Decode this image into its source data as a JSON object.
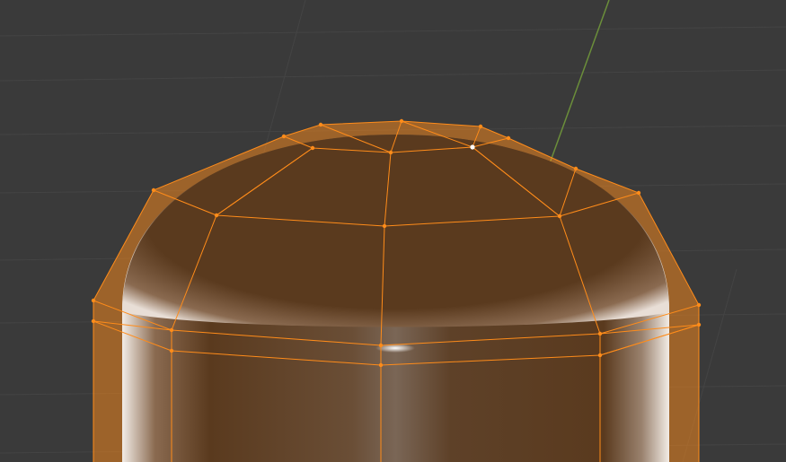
{
  "viewport": {
    "mode": "Edit Mode",
    "background_color": "#3a3a3a",
    "grid_color": "#444444",
    "y_axis_color": "#6b8e3a",
    "selection_color": "#ff8c1a"
  },
  "mesh": {
    "shading_color": "#5a3a1e",
    "selected_vertex_count": 40
  }
}
